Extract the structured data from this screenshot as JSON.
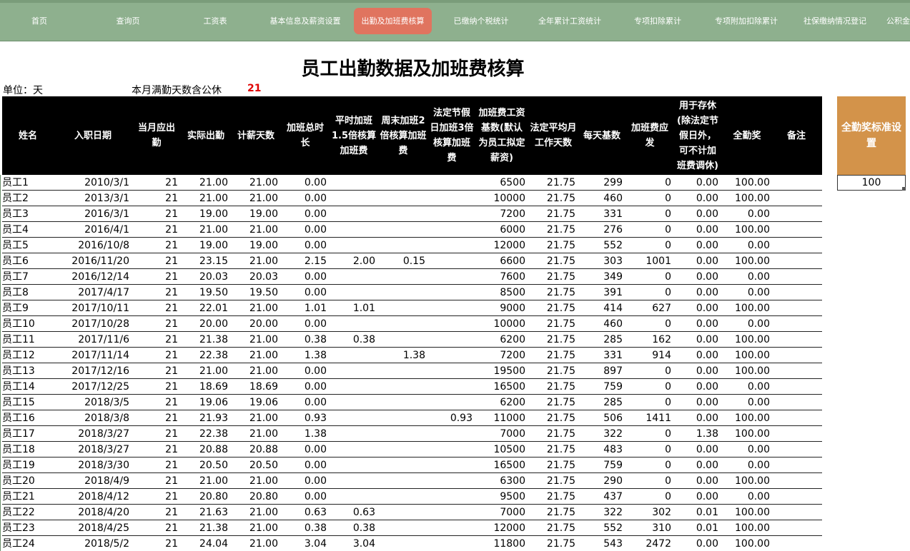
{
  "nav": {
    "items": [
      {
        "label": "首页"
      },
      {
        "label": "查询页"
      },
      {
        "label": "工资表"
      },
      {
        "label": "基本信息及薪资设置"
      },
      {
        "label": "出勤及加班费核算"
      },
      {
        "label": "已缴纳个税统计"
      },
      {
        "label": "全年累计工资统计"
      },
      {
        "label": "专项扣除累计"
      },
      {
        "label": "专项附加扣除累计"
      },
      {
        "label": "社保缴纳情况登记"
      },
      {
        "label": "公积金"
      }
    ],
    "active_index": 4,
    "background": "#8eb08e",
    "active_color": "#e0745f"
  },
  "sheet": {
    "title": "员工出勤数据及加班费核算",
    "unit_label": "单位：天",
    "full_days_label": "本月满勤天数含公休",
    "full_days_value": "21",
    "columns": [
      "姓名",
      "入职日期",
      "当月应出勤",
      "实际出勤",
      "计薪天数",
      "加班总时长",
      "平时加班1.5倍核算加班费",
      "周末加班2倍核算加班费",
      "法定节假日加班3倍核算加班费",
      "加班费工资基数(默认为员工拟定薪资)",
      "法定平均月工作天数",
      "每天基数",
      "加班费应发",
      "用于存休(除法定节假日外，可不计加班费调休)",
      "全勤奖",
      "备注"
    ],
    "rows": [
      [
        "员工1",
        "2010/3/1",
        "21",
        "21.00",
        "21.00",
        "0.00",
        "",
        "",
        "",
        "6500",
        "21.75",
        "299",
        "0",
        "0.00",
        "100.00",
        ""
      ],
      [
        "员工2",
        "2013/3/1",
        "21",
        "21.00",
        "21.00",
        "0.00",
        "",
        "",
        "",
        "10000",
        "21.75",
        "460",
        "0",
        "0.00",
        "100.00",
        ""
      ],
      [
        "员工3",
        "2016/3/1",
        "21",
        "19.00",
        "19.00",
        "0.00",
        "",
        "",
        "",
        "7200",
        "21.75",
        "331",
        "0",
        "0.00",
        "0.00",
        ""
      ],
      [
        "员工4",
        "2016/4/1",
        "21",
        "21.00",
        "21.00",
        "0.00",
        "",
        "",
        "",
        "6000",
        "21.75",
        "276",
        "0",
        "0.00",
        "100.00",
        ""
      ],
      [
        "员工5",
        "2016/10/8",
        "21",
        "19.00",
        "19.00",
        "0.00",
        "",
        "",
        "",
        "12000",
        "21.75",
        "552",
        "0",
        "0.00",
        "0.00",
        ""
      ],
      [
        "员工6",
        "2016/11/20",
        "21",
        "23.15",
        "21.00",
        "2.15",
        "2.00",
        "0.15",
        "",
        "6600",
        "21.75",
        "303",
        "1001",
        "0.00",
        "100.00",
        ""
      ],
      [
        "员工7",
        "2016/12/14",
        "21",
        "20.03",
        "20.03",
        "0.00",
        "",
        "",
        "",
        "7600",
        "21.75",
        "349",
        "0",
        "0.00",
        "0.00",
        ""
      ],
      [
        "员工8",
        "2017/4/17",
        "21",
        "19.50",
        "19.50",
        "0.00",
        "",
        "",
        "",
        "8500",
        "21.75",
        "391",
        "0",
        "0.00",
        "0.00",
        ""
      ],
      [
        "员工9",
        "2017/10/11",
        "21",
        "22.01",
        "21.00",
        "1.01",
        "1.01",
        "",
        "",
        "9000",
        "21.75",
        "414",
        "627",
        "0.00",
        "100.00",
        ""
      ],
      [
        "员工10",
        "2017/10/28",
        "21",
        "20.00",
        "20.00",
        "0.00",
        "",
        "",
        "",
        "10000",
        "21.75",
        "460",
        "0",
        "0.00",
        "0.00",
        ""
      ],
      [
        "员工11",
        "2017/11/6",
        "21",
        "21.38",
        "21.00",
        "0.38",
        "0.38",
        "",
        "",
        "6200",
        "21.75",
        "285",
        "162",
        "0.00",
        "100.00",
        ""
      ],
      [
        "员工12",
        "2017/11/14",
        "21",
        "22.38",
        "21.00",
        "1.38",
        "",
        "1.38",
        "",
        "7200",
        "21.75",
        "331",
        "914",
        "0.00",
        "100.00",
        ""
      ],
      [
        "员工13",
        "2017/12/16",
        "21",
        "21.00",
        "21.00",
        "0.00",
        "",
        "",
        "",
        "19500",
        "21.75",
        "897",
        "0",
        "0.00",
        "100.00",
        ""
      ],
      [
        "员工14",
        "2017/12/25",
        "21",
        "18.69",
        "18.69",
        "0.00",
        "",
        "",
        "",
        "16500",
        "21.75",
        "759",
        "0",
        "0.00",
        "0.00",
        ""
      ],
      [
        "员工15",
        "2018/3/5",
        "21",
        "19.06",
        "19.06",
        "0.00",
        "",
        "",
        "",
        "6200",
        "21.75",
        "285",
        "0",
        "0.00",
        "0.00",
        ""
      ],
      [
        "员工16",
        "2018/3/8",
        "21",
        "21.93",
        "21.00",
        "0.93",
        "",
        "",
        "0.93",
        "11000",
        "21.75",
        "506",
        "1411",
        "0.00",
        "100.00",
        ""
      ],
      [
        "员工17",
        "2018/3/27",
        "21",
        "22.38",
        "21.00",
        "1.38",
        "",
        "",
        "",
        "7000",
        "21.75",
        "322",
        "0",
        "1.38",
        "100.00",
        ""
      ],
      [
        "员工18",
        "2018/3/27",
        "21",
        "20.88",
        "20.88",
        "0.00",
        "",
        "",
        "",
        "10500",
        "21.75",
        "483",
        "0",
        "0.00",
        "0.00",
        ""
      ],
      [
        "员工19",
        "2018/3/30",
        "21",
        "20.50",
        "20.50",
        "0.00",
        "",
        "",
        "",
        "16500",
        "21.75",
        "759",
        "0",
        "0.00",
        "0.00",
        ""
      ],
      [
        "员工20",
        "2018/4/9",
        "21",
        "21.00",
        "21.00",
        "0.00",
        "",
        "",
        "",
        "6300",
        "21.75",
        "290",
        "0",
        "0.00",
        "100.00",
        ""
      ],
      [
        "员工21",
        "2018/4/12",
        "21",
        "20.80",
        "20.80",
        "0.00",
        "",
        "",
        "",
        "9500",
        "21.75",
        "437",
        "0",
        "0.00",
        "0.00",
        ""
      ],
      [
        "员工22",
        "2018/4/20",
        "21",
        "21.63",
        "21.00",
        "0.63",
        "0.63",
        "",
        "",
        "7000",
        "21.75",
        "322",
        "302",
        "0.01",
        "100.00",
        ""
      ],
      [
        "员工23",
        "2018/4/25",
        "21",
        "21.38",
        "21.00",
        "0.38",
        "0.38",
        "",
        "",
        "12000",
        "21.75",
        "552",
        "310",
        "0.01",
        "100.00",
        ""
      ],
      [
        "员工24",
        "2018/5/2",
        "21",
        "24.04",
        "21.00",
        "3.04",
        "3.04",
        "",
        "",
        "11800",
        "21.75",
        "543",
        "2472",
        "0.00",
        "100.00",
        ""
      ]
    ]
  },
  "bonus": {
    "header": "全勤奖标准设置",
    "value": "100",
    "color": "#d3934a"
  }
}
